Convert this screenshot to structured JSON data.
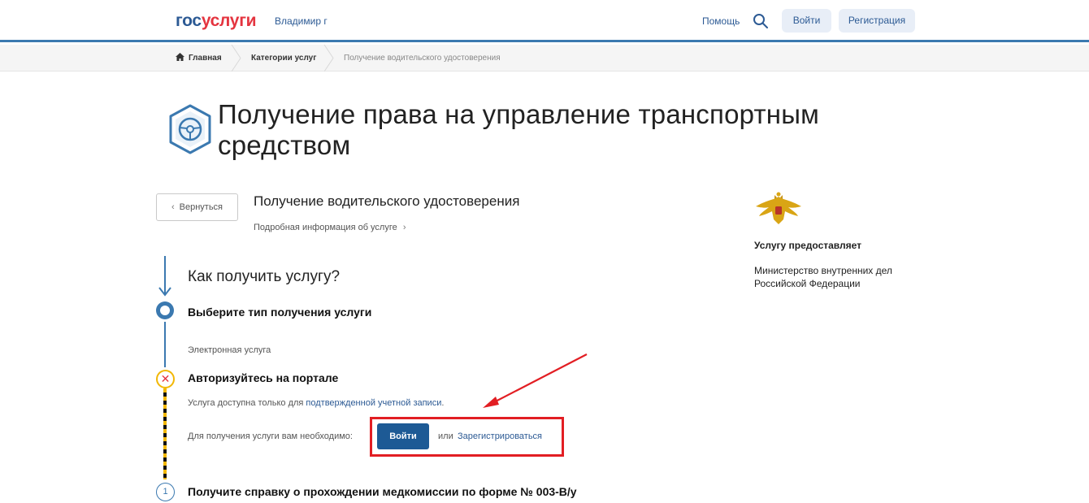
{
  "header": {
    "logo_gos": "гос",
    "logo_uslugi": "услуги",
    "region": "Владимир г",
    "help": "Помощь",
    "login_label": "Войти",
    "register_label": "Регистрация"
  },
  "breadcrumb": {
    "home": "Главная",
    "categories": "Категории услуг",
    "current": "Получение водительского удостоверения"
  },
  "page": {
    "title": "Получение права на управление транспортным средством",
    "back_label": "Вернуться",
    "sub_title": "Получение водительского удостоверения",
    "details_link": "Подробная информация об услуге"
  },
  "provider": {
    "label": "Услугу предоставляет",
    "name": "Министерство внутренних дел Российской Федерации"
  },
  "steps": {
    "how_title": "Как получить услугу?",
    "step1_title": "Выберите тип получения услуги",
    "step1_value": "Электронная услуга",
    "step2_title": "Авторизуйтесь на портале",
    "step2_note_prefix": "Услуга доступна только для ",
    "step2_note_link": "подтвержденной учетной записи",
    "step2_note_suffix": ".",
    "step2_need": "Для получения услуги вам необходимо:",
    "login_label": "Войти",
    "or_text": "или",
    "register_link": "Зарегистрироваться",
    "step3_number": "1",
    "step3_title": "Получите справку о прохождении медкомиссии по форме № 003-В/у"
  },
  "colors": {
    "brand_blue": "#2c5a94",
    "brand_red": "#e4343f",
    "highlight_red": "#e21e23",
    "primary_button": "#1d5a95"
  }
}
